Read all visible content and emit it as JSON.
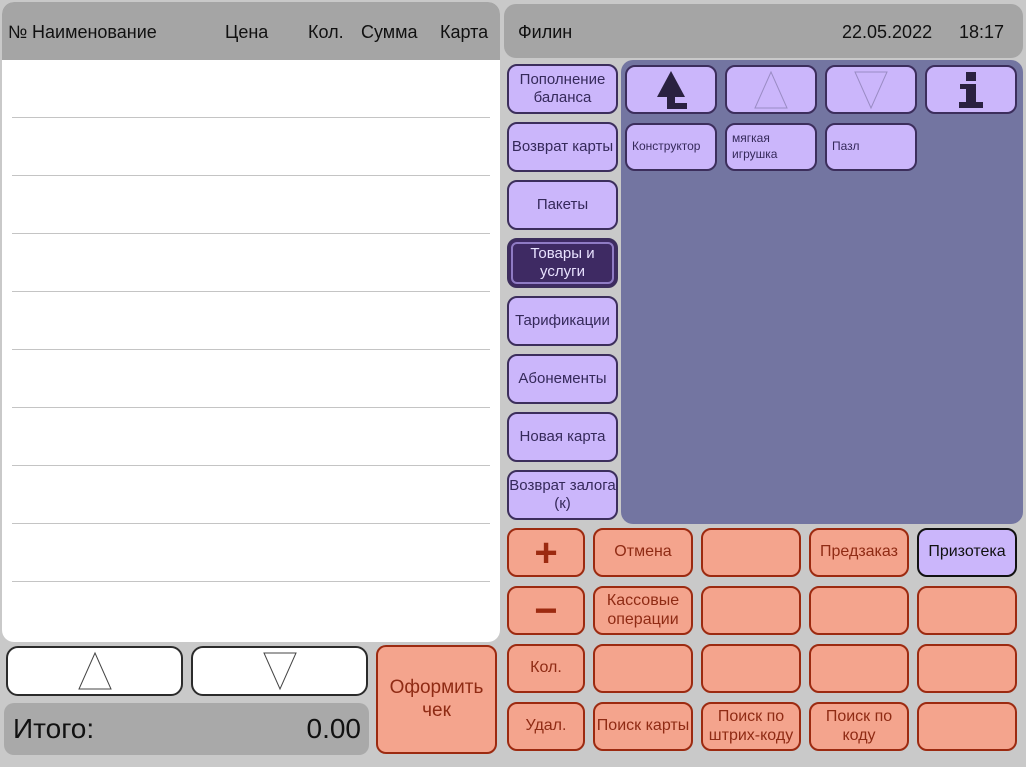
{
  "receipt": {
    "columns": [
      "№",
      "Наименование",
      "Цена",
      "Кол.",
      "Сумма",
      "Карта"
    ],
    "rows": [
      "",
      "",
      "",
      "",
      "",
      "",
      "",
      "",
      "",
      ""
    ]
  },
  "total": {
    "label": "Итого:",
    "value": "0.00"
  },
  "checkout": {
    "label": "Оформить чек"
  },
  "header": {
    "user": "Филин",
    "date": "22.05.2022",
    "time": "18:17"
  },
  "categories": [
    {
      "label": "Пополнение баланса"
    },
    {
      "label": "Возврат карты"
    },
    {
      "label": "Пакеты"
    },
    {
      "label": "Товары и услуги",
      "active": true
    },
    {
      "label": "Тарификации"
    },
    {
      "label": "Абонементы"
    },
    {
      "label": "Новая карта"
    },
    {
      "label": "Возврат залога (к)"
    }
  ],
  "nav_icons": [
    "tree-up-icon",
    "arrow-up-icon",
    "arrow-down-icon",
    "info-icon"
  ],
  "products": [
    "Конструктор",
    "мягкая игрушка",
    "Пазл"
  ],
  "actions": {
    "plus": "+",
    "minus": "−",
    "qty": "Кол.",
    "delete": "Удал.",
    "cancel": "Отмена",
    "cash_ops": "Кассовые операции",
    "search_card": "Поиск карты",
    "search_barcode": "Поиск по штрих-коду",
    "search_code": "Поиск по коду",
    "preorder": "Предзаказ",
    "prize_library": "Призотека"
  },
  "colors": {
    "salmon": "#f4a48d",
    "violet": "#cbb6fb",
    "active": "#3e2a63",
    "panel": "#7375a1",
    "header": "#a5a5a5"
  }
}
